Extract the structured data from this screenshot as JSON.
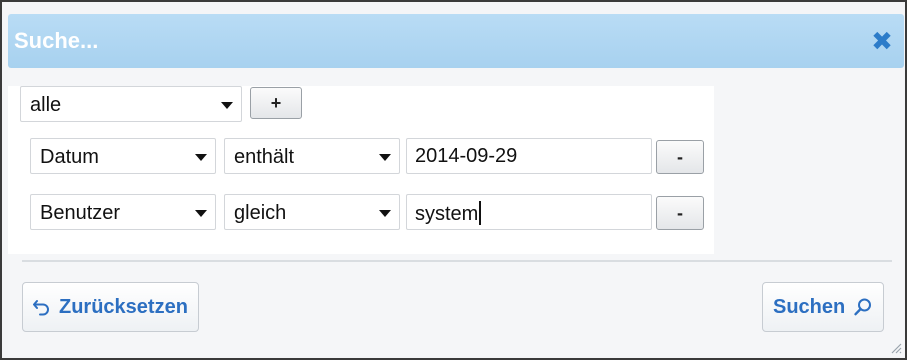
{
  "dialog": {
    "title": "Suche...",
    "close_icon": "close-icon"
  },
  "filter": {
    "scope": {
      "selected": "alle"
    },
    "add_label": "+",
    "rows": [
      {
        "field": "Datum",
        "operator": "enthält",
        "value": "2014-09-29",
        "remove_label": "-"
      },
      {
        "field": "Benutzer",
        "operator": "gleich",
        "value": "system",
        "remove_label": "-"
      }
    ]
  },
  "actions": {
    "reset_label": "Zurücksetzen",
    "reset_icon": "undo-arrow-icon",
    "search_label": "Suchen",
    "search_icon": "search-icon"
  },
  "colors": {
    "titlebar": "#a7d1ef",
    "accent": "#2c6fc1",
    "close": "#2c7cc9"
  }
}
